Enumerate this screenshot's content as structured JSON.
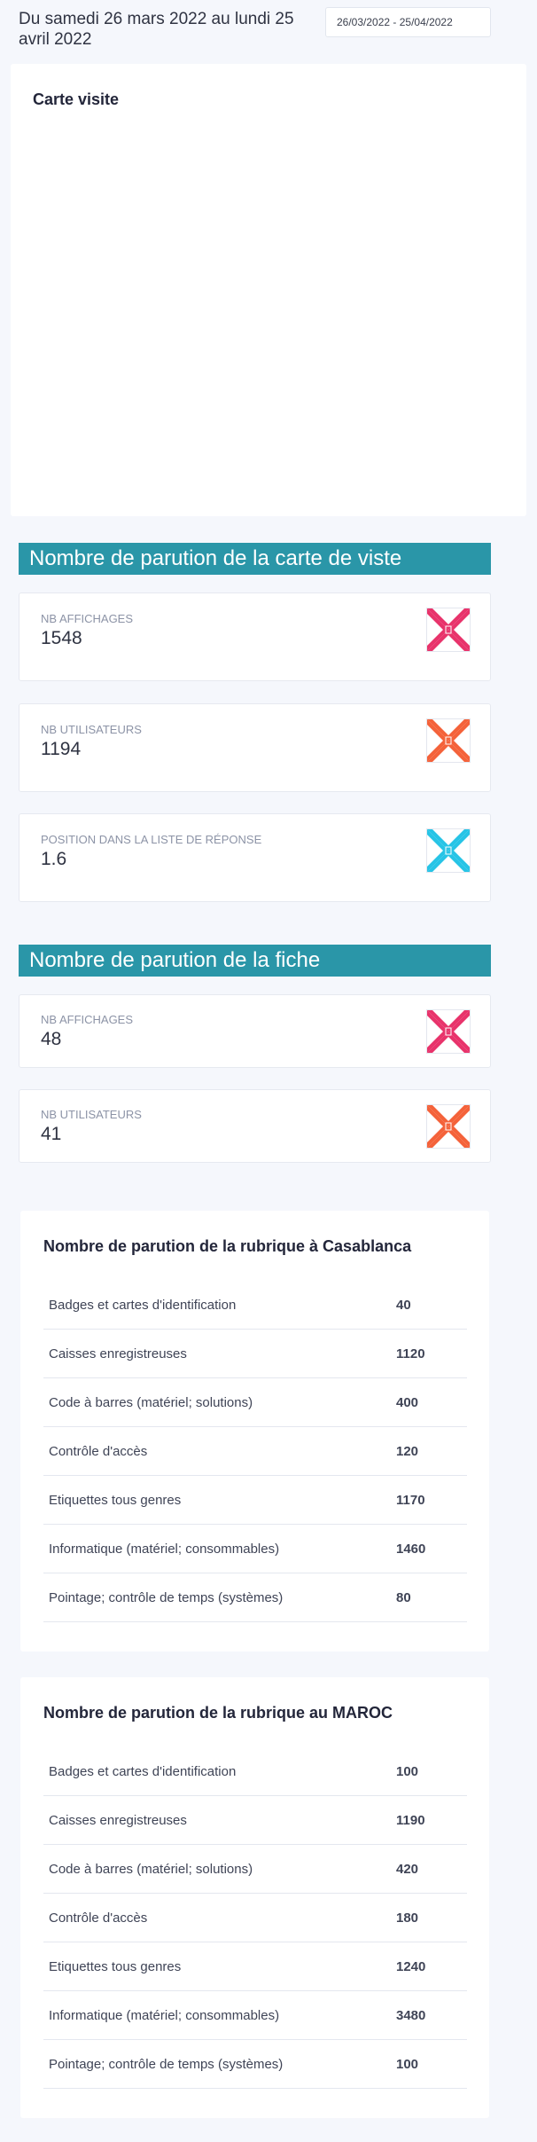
{
  "header": {
    "period_text": "Du samedi 26 mars 2022 au lundi 25 avril 2022",
    "date_range_value": "26/03/2022 - 25/04/2022"
  },
  "carte_visite": {
    "title": "Carte visite"
  },
  "section_carte": {
    "title": "Nombre de parution de la carte de viste",
    "stats": [
      {
        "label": "NB AFFICHAGES",
        "value": "1548",
        "icon": "eye-icon",
        "color": "#e8336b"
      },
      {
        "label": "NB UTILISATEURS",
        "value": "1194",
        "icon": "users-icon",
        "color": "#f4623a"
      },
      {
        "label": "POSITION DANS LA LISTE DE RÉPONSE",
        "value": "1.6",
        "icon": "list-icon",
        "color": "#27c4e6"
      }
    ]
  },
  "section_fiche": {
    "title": "Nombre de parution de la fiche",
    "stats": [
      {
        "label": "NB AFFICHAGES",
        "value": "48",
        "icon": "eye-icon",
        "color": "#e8336b"
      },
      {
        "label": "NB UTILISATEURS",
        "value": "41",
        "icon": "users-icon",
        "color": "#f4623a"
      }
    ]
  },
  "rubrique_casablanca": {
    "title": "Nombre de parution de la rubrique à Casablanca",
    "rows": [
      {
        "label": "Badges et cartes d'identification",
        "value": "40"
      },
      {
        "label": "Caisses enregistreuses",
        "value": "1120"
      },
      {
        "label": "Code à barres (matériel; solutions)",
        "value": "400"
      },
      {
        "label": "Contrôle d'accès",
        "value": "120"
      },
      {
        "label": "Etiquettes tous genres",
        "value": "1170"
      },
      {
        "label": "Informatique (matériel; consommables)",
        "value": "1460"
      },
      {
        "label": "Pointage; contrôle de temps (systèmes)",
        "value": "80"
      }
    ]
  },
  "rubrique_maroc": {
    "title": "Nombre de parution de la rubrique au MAROC",
    "rows": [
      {
        "label": "Badges et cartes d'identification",
        "value": "100"
      },
      {
        "label": "Caisses enregistreuses",
        "value": "1190"
      },
      {
        "label": "Code à barres (matériel; solutions)",
        "value": "420"
      },
      {
        "label": "Contrôle d'accès",
        "value": "180"
      },
      {
        "label": "Etiquettes tous genres",
        "value": "1240"
      },
      {
        "label": "Informatique (matériel; consommables)",
        "value": "3480"
      },
      {
        "label": "Pointage; contrôle de temps (systèmes)",
        "value": "100"
      }
    ]
  }
}
